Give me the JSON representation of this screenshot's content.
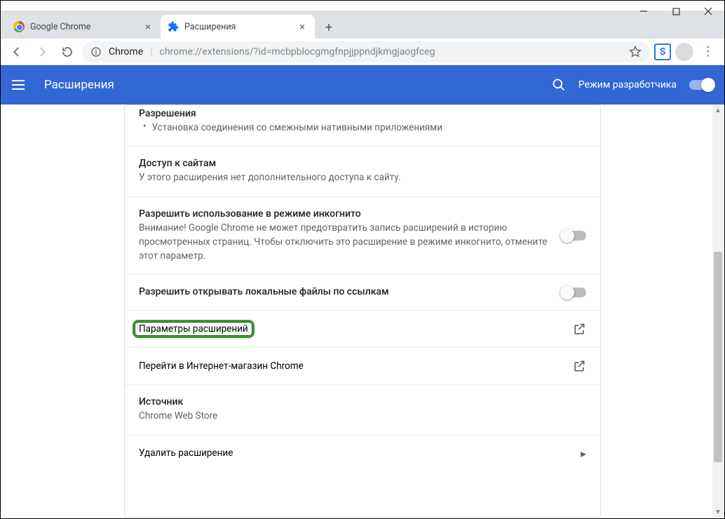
{
  "window": {
    "tabs": [
      {
        "title": "Google Chrome",
        "active": false
      },
      {
        "title": "Расширения",
        "active": true
      }
    ],
    "url_host": "Chrome",
    "url_path": "chrome://extensions/?id=mcbpblocgmgfnpjjppndjkmgjaogfceg"
  },
  "header": {
    "title": "Расширения",
    "dev_mode_label": "Режим разработчика"
  },
  "sections": {
    "permissions_title": "Разрешения",
    "permissions_item": "Установка соединения со смежными нативными приложениями",
    "site_access_title": "Доступ к сайтам",
    "site_access_desc": "У этого расширения нет дополнительного доступа к сайту.",
    "incognito_title": "Разрешить использование в режиме инкогнито",
    "incognito_desc": "Внимание! Google Chrome не может предотвратить запись расширений в историю просмотренных страниц. Чтобы отключить это расширение в режиме инкогнито, отмените этот параметр.",
    "file_urls_title": "Разрешить открывать локальные файлы по ссылкам",
    "options_label": "Параметры расширений",
    "webstore_label": "Перейти в Интернет-магазин Chrome",
    "source_title": "Источник",
    "source_value": "Chrome Web Store",
    "remove_label": "Удалить расширение"
  }
}
